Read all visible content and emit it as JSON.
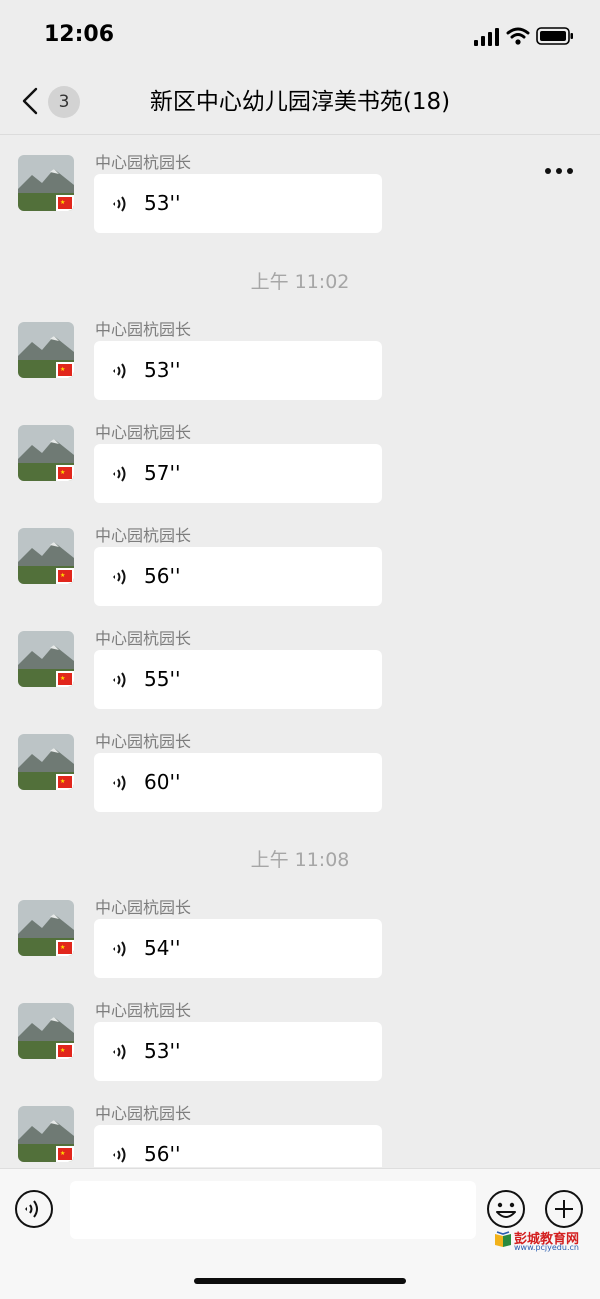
{
  "status_bar": {
    "time": "12:06"
  },
  "header": {
    "back_badge": "3",
    "title": "新区中心幼儿园淳美书苑(18)"
  },
  "chat": {
    "messages": [
      {
        "sender": "中心园杭园长",
        "duration": "53''"
      },
      {
        "timestamp": "上午 11:02"
      },
      {
        "sender": "中心园杭园长",
        "duration": "53''"
      },
      {
        "sender": "中心园杭园长",
        "duration": "57''"
      },
      {
        "sender": "中心园杭园长",
        "duration": "56''"
      },
      {
        "sender": "中心园杭园长",
        "duration": "55''"
      },
      {
        "sender": "中心园杭园长",
        "duration": "60''"
      },
      {
        "timestamp": "上午 11:08"
      },
      {
        "sender": "中心园杭园长",
        "duration": "54''"
      },
      {
        "sender": "中心园杭园长",
        "duration": "53''"
      },
      {
        "sender": "中心园杭园长",
        "duration": "56''"
      }
    ]
  },
  "input": {
    "placeholder": ""
  },
  "watermark": {
    "text": "彭城教育网",
    "url": "www.pcjyedu.cn"
  },
  "colors": {
    "background": "#ededed",
    "bubble": "#ffffff",
    "sender": "#7d7d7d",
    "timestamp": "#a6a6a6"
  },
  "icons": {
    "voice": "voice-wave-icon",
    "emoji": "smiley-icon",
    "plus": "plus-circle-icon",
    "back": "chevron-left-icon",
    "more": "more-dots-icon"
  }
}
